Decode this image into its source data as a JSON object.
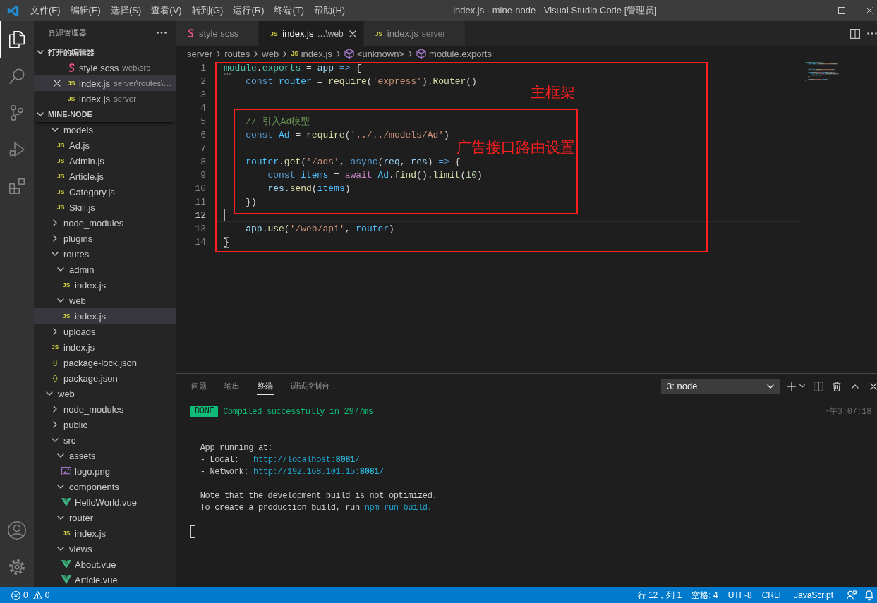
{
  "title_bar": {
    "menu": [
      "文件(F)",
      "编辑(E)",
      "选择(S)",
      "查看(V)",
      "转到(G)",
      "运行(R)",
      "终端(T)",
      "帮助(H)"
    ],
    "title": "index.js - mine-node - Visual Studio Code [管理员]"
  },
  "activity_bar": {
    "items": [
      {
        "kind": "files",
        "selected": true
      },
      {
        "kind": "search",
        "selected": false
      },
      {
        "kind": "source-control",
        "selected": false
      },
      {
        "kind": "run-debug",
        "selected": false
      },
      {
        "kind": "extensions",
        "selected": false
      }
    ],
    "bottom_items": [
      {
        "kind": "account"
      },
      {
        "kind": "settings"
      }
    ]
  },
  "sidebar": {
    "title": "资源管理器",
    "open_editors": {
      "title": "打开的编辑器",
      "expanded": true,
      "items": [
        {
          "label": "style.scss",
          "description": "web\\src",
          "kind": "scss",
          "selected": false
        },
        {
          "label": "index.js",
          "description": "server\\routes\\…",
          "kind": "js",
          "glyph": "JS",
          "selected": true
        },
        {
          "label": "index.js",
          "description": "server",
          "kind": "js",
          "glyph": "JS",
          "selected": false
        }
      ]
    },
    "workspace": {
      "title": "MINE-NODE",
      "expanded": true,
      "tree": [
        {
          "children": [
            {
              "label": "models",
              "kind": "folder",
              "expanded": true,
              "selected": false,
              "children": [
                {
                  "label": "Ad.js",
                  "kind": "js",
                  "glyph": "JS",
                  "selected": false
                },
                {
                  "label": "Admin.js",
                  "kind": "js",
                  "glyph": "JS",
                  "selected": false
                },
                {
                  "label": "Article.js",
                  "kind": "js",
                  "glyph": "JS",
                  "selected": false
                },
                {
                  "label": "Category.js",
                  "kind": "js",
                  "glyph": "JS",
                  "selected": false
                },
                {
                  "label": "Skill.js",
                  "kind": "js",
                  "glyph": "JS",
                  "selected": false
                }
              ]
            },
            {
              "label": "node_modules",
              "kind": "folder",
              "expanded": false,
              "selected": false
            },
            {
              "label": "plugins",
              "kind": "folder",
              "expanded": false,
              "selected": false
            },
            {
              "label": "routes",
              "kind": "folder",
              "expanded": true,
              "selected": false,
              "children": [
                {
                  "label": "admin",
                  "kind": "folder",
                  "expanded": true,
                  "selected": false,
                  "children": [
                    {
                      "label": "index.js",
                      "kind": "js",
                      "glyph": "JS",
                      "selected": false
                    }
                  ]
                },
                {
                  "label": "web",
                  "kind": "folder",
                  "expanded": true,
                  "selected": false,
                  "children": [
                    {
                      "label": "index.js",
                      "kind": "js",
                      "glyph": "JS",
                      "selected": true
                    }
                  ]
                }
              ]
            },
            {
              "label": "uploads",
              "kind": "folder",
              "expanded": false,
              "selected": false
            },
            {
              "label": "index.js",
              "kind": "js",
              "glyph": "JS",
              "selected": false
            },
            {
              "label": "package-lock.json",
              "kind": "json",
              "glyph": "{}",
              "selected": false
            },
            {
              "label": "package.json",
              "kind": "json",
              "glyph": "{}",
              "selected": false
            }
          ]
        },
        {
          "label": "web",
          "kind": "folder",
          "expanded": true,
          "selected": false,
          "children": [
            {
              "label": "node_modules",
              "kind": "folder",
              "expanded": false,
              "selected": false
            },
            {
              "label": "public",
              "kind": "folder",
              "expanded": false,
              "selected": false
            },
            {
              "label": "src",
              "kind": "folder",
              "expanded": true,
              "selected": false,
              "children": [
                {
                  "label": "assets",
                  "kind": "folder",
                  "expanded": true,
                  "selected": false,
                  "children": [
                    {
                      "label": "logo.png",
                      "kind": "image",
                      "selected": false
                    }
                  ]
                },
                {
                  "label": "components",
                  "kind": "folder",
                  "expanded": true,
                  "selected": false,
                  "children": [
                    {
                      "label": "HelloWorld.vue",
                      "kind": "vue",
                      "selected": false
                    }
                  ]
                },
                {
                  "label": "router",
                  "kind": "folder",
                  "expanded": true,
                  "selected": false,
                  "children": [
                    {
                      "label": "index.js",
                      "kind": "js",
                      "glyph": "JS",
                      "selected": false
                    }
                  ]
                },
                {
                  "label": "views",
                  "kind": "folder",
                  "expanded": true,
                  "selected": false,
                  "children": [
                    {
                      "label": "About.vue",
                      "kind": "vue",
                      "selected": false
                    },
                    {
                      "label": "Article.vue",
                      "kind": "vue",
                      "selected": false
                    }
                  ]
                }
              ]
            }
          ]
        }
      ]
    }
  },
  "editor": {
    "tabs": [
      {
        "label": "style.scss",
        "kind": "scss",
        "selected": false
      },
      {
        "label": "index.js",
        "description": "…\\web",
        "kind": "js",
        "glyph": "JS",
        "selected": true
      },
      {
        "label": "index.js",
        "description": "server",
        "kind": "js",
        "glyph": "JS",
        "selected": false
      }
    ],
    "breadcrumb": [
      {
        "label": "server",
        "kind": "folder"
      },
      {
        "label": "routes",
        "kind": "folder"
      },
      {
        "label": "web",
        "kind": "folder"
      },
      {
        "label": "index.js",
        "kind": "js",
        "glyph": "JS"
      },
      {
        "label": "<unknown>",
        "kind": "symbol"
      },
      {
        "label": "module.exports",
        "kind": "symbol"
      }
    ],
    "lines": [
      {
        "number": "1",
        "current": false,
        "suggestion": true,
        "tokens": [
          {
            "kind": "type",
            "text": "module"
          },
          {
            "kind": "plain",
            "text": "."
          },
          {
            "kind": "type",
            "text": "exports"
          },
          {
            "kind": "plain",
            "text": " = "
          },
          {
            "kind": "param",
            "text": "app"
          },
          {
            "kind": "keyword",
            "text": " => "
          },
          {
            "kind": "bracket-match",
            "text": "{"
          }
        ]
      },
      {
        "number": "2",
        "current": false,
        "suggestion": false,
        "tokens": [
          {
            "kind": "keyword",
            "text": "    const "
          },
          {
            "kind": "constant",
            "text": "router"
          },
          {
            "kind": "plain",
            "text": " = "
          },
          {
            "kind": "function",
            "text": "require"
          },
          {
            "kind": "plain",
            "text": "("
          },
          {
            "kind": "string",
            "text": "'express'"
          },
          {
            "kind": "plain",
            "text": ")."
          },
          {
            "kind": "function",
            "text": "Router"
          },
          {
            "kind": "plain",
            "text": "()"
          }
        ]
      },
      {
        "number": "3",
        "current": false,
        "suggestion": false
      },
      {
        "number": "4",
        "current": false,
        "suggestion": false
      },
      {
        "number": "5",
        "current": false,
        "suggestion": false,
        "tokens": [
          {
            "kind": "comment",
            "text": "    // 引入Ad模型"
          }
        ]
      },
      {
        "number": "6",
        "current": false,
        "suggestion": false,
        "tokens": [
          {
            "kind": "keyword",
            "text": "    const "
          },
          {
            "kind": "constant",
            "text": "Ad"
          },
          {
            "kind": "plain",
            "text": " = "
          },
          {
            "kind": "function",
            "text": "require"
          },
          {
            "kind": "plain",
            "text": "("
          },
          {
            "kind": "string",
            "text": "'../../models/Ad'"
          },
          {
            "kind": "plain",
            "text": ")"
          }
        ]
      },
      {
        "number": "7",
        "current": false,
        "suggestion": false
      },
      {
        "number": "8",
        "current": false,
        "suggestion": false,
        "tokens": [
          {
            "kind": "constant",
            "text": "    router"
          },
          {
            "kind": "plain",
            "text": "."
          },
          {
            "kind": "function",
            "text": "get"
          },
          {
            "kind": "plain",
            "text": "("
          },
          {
            "kind": "string",
            "text": "'/ads'"
          },
          {
            "kind": "plain",
            "text": ", "
          },
          {
            "kind": "keyword",
            "text": "async"
          },
          {
            "kind": "plain",
            "text": "("
          },
          {
            "kind": "param",
            "text": "req"
          },
          {
            "kind": "plain",
            "text": ", "
          },
          {
            "kind": "param",
            "text": "res"
          },
          {
            "kind": "plain",
            "text": ") "
          },
          {
            "kind": "keyword",
            "text": "=>"
          },
          {
            "kind": "plain",
            "text": " {"
          }
        ]
      },
      {
        "number": "9",
        "current": false,
        "suggestion": false,
        "tokens": [
          {
            "kind": "keyword",
            "text": "        const "
          },
          {
            "kind": "constant",
            "text": "items"
          },
          {
            "kind": "plain",
            "text": " = "
          },
          {
            "kind": "control",
            "text": "await "
          },
          {
            "kind": "constant",
            "text": "Ad"
          },
          {
            "kind": "plain",
            "text": "."
          },
          {
            "kind": "function",
            "text": "find"
          },
          {
            "kind": "plain",
            "text": "()."
          },
          {
            "kind": "function",
            "text": "limit"
          },
          {
            "kind": "plain",
            "text": "("
          },
          {
            "kind": "number",
            "text": "10"
          },
          {
            "kind": "plain",
            "text": ")"
          }
        ]
      },
      {
        "number": "10",
        "current": false,
        "suggestion": false,
        "tokens": [
          {
            "kind": "param",
            "text": "        res"
          },
          {
            "kind": "plain",
            "text": "."
          },
          {
            "kind": "function",
            "text": "send"
          },
          {
            "kind": "plain",
            "text": "("
          },
          {
            "kind": "constant",
            "text": "items"
          },
          {
            "kind": "plain",
            "text": ")"
          }
        ]
      },
      {
        "number": "11",
        "current": false,
        "suggestion": false,
        "tokens": [
          {
            "kind": "plain",
            "text": "    })"
          }
        ]
      },
      {
        "number": "12",
        "current": true,
        "suggestion": false
      },
      {
        "number": "13",
        "current": false,
        "suggestion": false,
        "tokens": [
          {
            "kind": "param",
            "text": "    app"
          },
          {
            "kind": "plain",
            "text": "."
          },
          {
            "kind": "function",
            "text": "use"
          },
          {
            "kind": "plain",
            "text": "("
          },
          {
            "kind": "string",
            "text": "'/web/api'"
          },
          {
            "kind": "plain",
            "text": ", "
          },
          {
            "kind": "constant",
            "text": "router"
          },
          {
            "kind": "plain",
            "text": ")"
          }
        ]
      },
      {
        "number": "14",
        "current": false,
        "suggestion": false,
        "tokens": [
          {
            "kind": "bracket-match",
            "text": "}"
          }
        ]
      }
    ],
    "annotations": [
      {
        "label": "主框架"
      },
      {
        "label": "广告接口路由设置"
      }
    ]
  },
  "panel": {
    "tabs": [
      {
        "label": "问题",
        "selected": false
      },
      {
        "label": "输出",
        "selected": false
      },
      {
        "label": "终端",
        "selected": true
      },
      {
        "label": "调试控制台",
        "selected": false
      }
    ],
    "terminal_select": {
      "value": "3: node"
    },
    "terminal": {
      "lines": [
        {
          "kind": "output",
          "segments": [
            {
              "kind": "badge",
              "text": "DONE"
            },
            {
              "kind": "success",
              "text": " Compiled successfully in 2977ms"
            }
          ],
          "timestamp": "下午3:07:18"
        },
        {
          "kind": "blank"
        },
        {
          "kind": "blank"
        },
        {
          "kind": "output",
          "segments": [
            {
              "kind": "plain",
              "text": "  App running at:"
            }
          ]
        },
        {
          "kind": "output",
          "segments": [
            {
              "kind": "plain",
              "text": "  - Local:   "
            },
            {
              "kind": "link",
              "text": "http://localhost:"
            },
            {
              "kind": "link-bold",
              "text": "8081"
            },
            {
              "kind": "link",
              "text": "/"
            }
          ]
        },
        {
          "kind": "output",
          "segments": [
            {
              "kind": "plain",
              "text": "  - Network: "
            },
            {
              "kind": "link",
              "text": "http://192.168.101.15:"
            },
            {
              "kind": "link-bold",
              "text": "8081"
            },
            {
              "kind": "link",
              "text": "/"
            }
          ]
        },
        {
          "kind": "blank"
        },
        {
          "kind": "output",
          "segments": [
            {
              "kind": "plain",
              "text": "  Note that the development build is not optimized."
            }
          ]
        },
        {
          "kind": "output",
          "segments": [
            {
              "kind": "plain",
              "text": "  To create a production build, run "
            },
            {
              "kind": "command",
              "text": "npm run build"
            },
            {
              "kind": "plain",
              "text": "."
            }
          ]
        },
        {
          "kind": "blank"
        },
        {
          "kind": "cursor"
        }
      ]
    }
  },
  "status_bar": {
    "errors": "0",
    "warnings": "0",
    "items": [
      "行 12，列 1",
      "空格: 4",
      "UTF-8",
      "CRLF",
      "JavaScript"
    ]
  }
}
